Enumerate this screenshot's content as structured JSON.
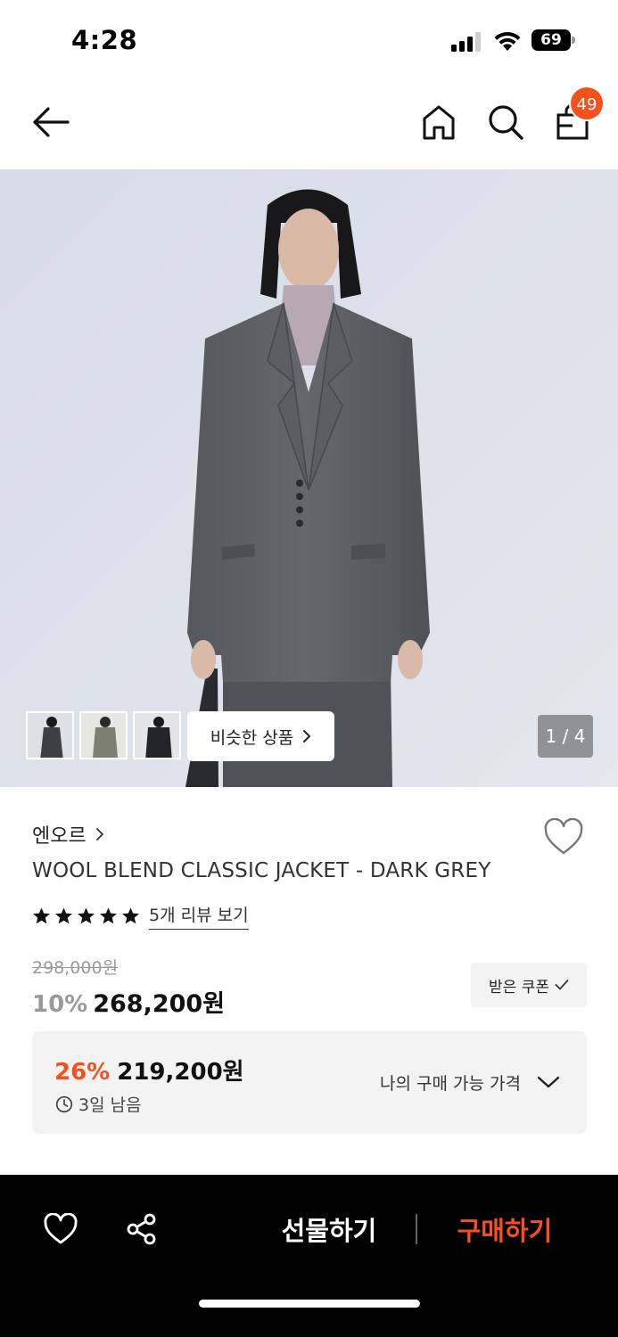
{
  "status_bar": {
    "time": "4:28",
    "battery": "69"
  },
  "header": {
    "cart_count": "49"
  },
  "gallery": {
    "page_indicator": "1 / 4",
    "similar_button_label": "비슷한 상품"
  },
  "product": {
    "brand": "엔오르",
    "name": "WOOL BLEND CLASSIC JACKET - DARK GREY",
    "rating_stars": 5,
    "review_link": "5개 리뷰 보기",
    "original_price": "298,000원",
    "discount_rate": "10%",
    "sale_price": "268,200원",
    "coupon_button": "받은 쿠폰"
  },
  "best_price": {
    "discount_rate": "26%",
    "price": "219,200원",
    "time_left": "3일 남음",
    "label": "나의 구매 가능 가격"
  },
  "bottom_bar": {
    "gift_label": "선물하기",
    "buy_label": "구매하기"
  },
  "colors": {
    "accent": "#f4511e",
    "bottom_bar_bg": "#000000",
    "muted_text": "#9a9a9a",
    "panel_bg": "#f3f3f3"
  }
}
